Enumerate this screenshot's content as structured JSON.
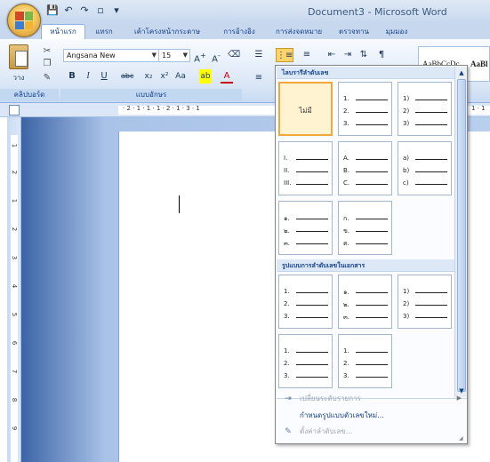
{
  "window": {
    "title": "Document3 - Microsoft Word"
  },
  "quick_access": {
    "icons": [
      "save-icon",
      "undo-icon",
      "redo-icon",
      "new-document-icon",
      "customize-icon"
    ]
  },
  "ribbon_tabs": [
    "หน้าแรก",
    "แทรก",
    "เค้าโครงหน้ากระดาษ",
    "การอ้างอิง",
    "การส่งจดหมาย",
    "ตรวจทาน",
    "มุมมอง"
  ],
  "clipboard": {
    "paste_label": "วาง",
    "group_label": "คลิปบอร์ด"
  },
  "font": {
    "family": "Angsana New",
    "size": "15",
    "group_label": "แบบอักษร"
  },
  "styles": {
    "sample_1": "AaBbCcDc",
    "sample_2": "AaBl"
  },
  "ruler": {
    "h_text": "· 2 · 1 · 1 · 1 · 2 · 1 · 3 · 1",
    "h_text_right": "1 · 1"
  },
  "vruler_numbers": [
    "1",
    "2",
    "1",
    "2",
    "3",
    "4",
    "5",
    "6",
    "7",
    "8",
    "9",
    "10",
    "11"
  ],
  "numbering_gallery": {
    "recent_header": "ไลบรารีลำดับเลข",
    "none_label": "ไม่มี",
    "doc_header": "รูปแบบการลำดับเลขในเอกสาร",
    "formats": [
      [
        "1.",
        "2.",
        "3."
      ],
      [
        "1)",
        "2)",
        "3)"
      ],
      [
        "I.",
        "II.",
        "III."
      ],
      [
        "A.",
        "B.",
        "C."
      ],
      [
        "a)",
        "b)",
        "c)"
      ],
      [
        "๑.",
        "๒.",
        "๓."
      ],
      [
        "ก.",
        "ข.",
        "ค."
      ]
    ],
    "doc_formats": [
      [
        "1.",
        "2.",
        "3."
      ],
      [
        "๑.",
        "๒.",
        "๓."
      ],
      [
        "1)",
        "2)",
        "3)"
      ],
      [
        "1.",
        "2.",
        "3."
      ],
      [
        "1.",
        "2.",
        "3."
      ]
    ]
  },
  "menu": {
    "change_level": "เปลี่ยนระดับรายการ",
    "define_new": "กำหนดรูปแบบตัวเลขใหม่...",
    "set_value": "ตั้งค่าลำดับเลข..."
  }
}
